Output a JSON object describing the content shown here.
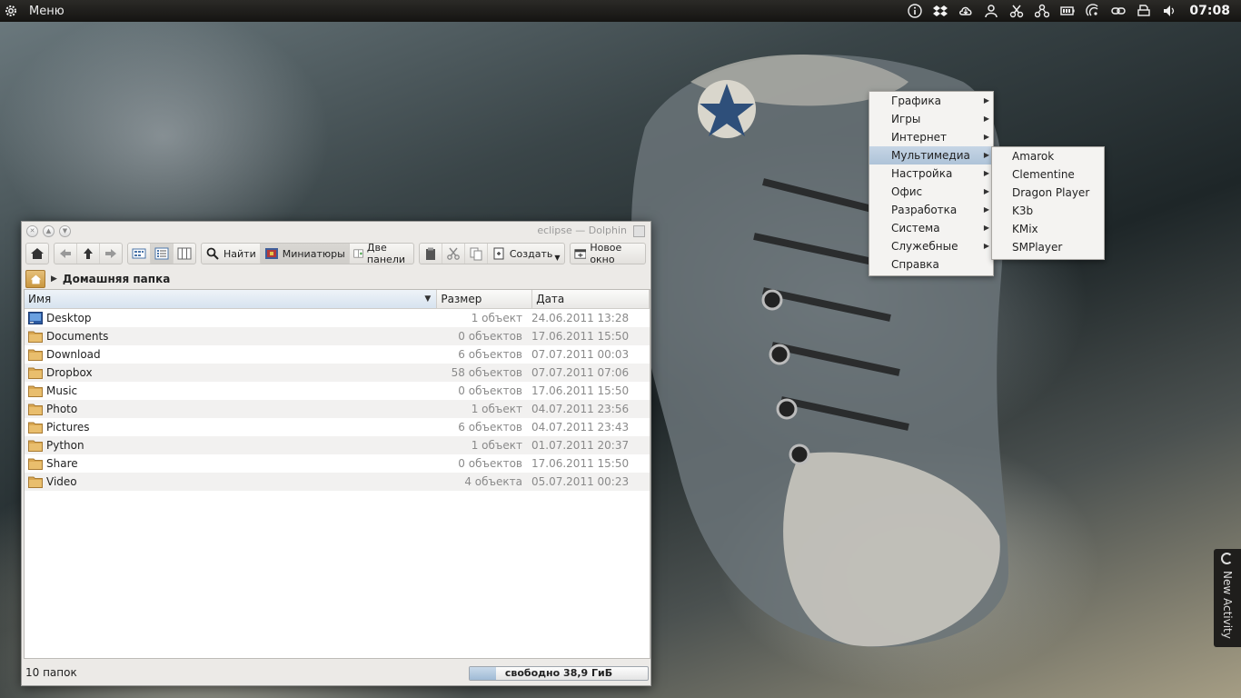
{
  "top_panel": {
    "menu_label": "Меню",
    "clock": "07:08",
    "tray_icons": [
      "info-icon",
      "dropbox-icon",
      "cloud-icon",
      "user-icon",
      "scissors-icon",
      "network-icon",
      "battery-icon",
      "wifi-icon",
      "link-icon",
      "printer-icon",
      "volume-icon"
    ]
  },
  "dolphin": {
    "title": "eclipse — Dolphin",
    "toolbar": {
      "find_label": "Найти",
      "previews_label": "Миниатюры",
      "split_label": "Две панели",
      "create_label": "Создать",
      "new_window_label": "Новое окно"
    },
    "breadcrumb_label": "Домашняя папка",
    "columns": {
      "name": "Имя",
      "size": "Размер",
      "date": "Дата"
    },
    "files": [
      {
        "name": "Desktop",
        "size": "1 объект",
        "date": "24.06.2011 13:28",
        "icon": "desktop-icon"
      },
      {
        "name": "Documents",
        "size": "0 объектов",
        "date": "17.06.2011 15:50",
        "icon": "folder-icon"
      },
      {
        "name": "Download",
        "size": "6 объектов",
        "date": "07.07.2011 00:03",
        "icon": "folder-icon"
      },
      {
        "name": "Dropbox",
        "size": "58 объектов",
        "date": "07.07.2011 07:06",
        "icon": "folder-icon"
      },
      {
        "name": "Music",
        "size": "0 объектов",
        "date": "17.06.2011 15:50",
        "icon": "folder-icon"
      },
      {
        "name": "Photo",
        "size": "1 объект",
        "date": "04.07.2011 23:56",
        "icon": "folder-icon"
      },
      {
        "name": "Pictures",
        "size": "6 объектов",
        "date": "04.07.2011 23:43",
        "icon": "folder-icon"
      },
      {
        "name": "Python",
        "size": "1 объект",
        "date": "01.07.2011 20:37",
        "icon": "folder-icon"
      },
      {
        "name": "Share",
        "size": "0 объектов",
        "date": "17.06.2011 15:50",
        "icon": "folder-icon"
      },
      {
        "name": "Video",
        "size": "4 объекта",
        "date": "05.07.2011 00:23",
        "icon": "folder-icon"
      }
    ],
    "status": {
      "text": "10 папок",
      "free_space": "свободно 38,9 ГиБ",
      "used_fraction": 0.15
    }
  },
  "app_menu": {
    "items": [
      {
        "label": "Графика",
        "submenu": true
      },
      {
        "label": "Игры",
        "submenu": true
      },
      {
        "label": "Интернет",
        "submenu": true
      },
      {
        "label": "Мультимедиа",
        "submenu": true,
        "highlighted": true
      },
      {
        "label": "Настройка",
        "submenu": true
      },
      {
        "label": "Офис",
        "submenu": true
      },
      {
        "label": "Разработка",
        "submenu": true
      },
      {
        "label": "Система",
        "submenu": true
      },
      {
        "label": "Служебные",
        "submenu": true
      },
      {
        "label": "Справка",
        "submenu": false
      }
    ],
    "multimedia_submenu": [
      "Amarok",
      "Clementine",
      "Dragon Player",
      "K3b",
      "KMix",
      "SMPlayer"
    ]
  },
  "activity_tab": {
    "label": "New Activity"
  },
  "colors": {
    "panel": "#1a1917",
    "highlight": "#aec3d8",
    "folder": "#d9a751"
  }
}
